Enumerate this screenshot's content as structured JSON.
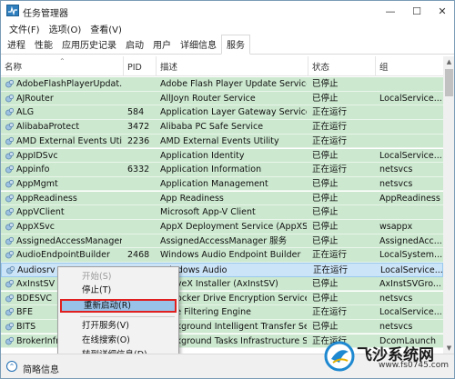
{
  "window": {
    "title": "任务管理器"
  },
  "menu": [
    "文件(F)",
    "选项(O)",
    "查看(V)"
  ],
  "tabs": [
    "进程",
    "性能",
    "应用历史记录",
    "启动",
    "用户",
    "详细信息",
    "服务"
  ],
  "active_tab": 6,
  "columns": {
    "name": "名称",
    "pid": "PID",
    "desc": "描述",
    "status": "状态",
    "group": "组"
  },
  "rows": [
    {
      "name": "AdobeFlashPlayerUpdat...",
      "pid": "",
      "desc": "Adobe Flash Player Update Service",
      "status": "已停止",
      "group": ""
    },
    {
      "name": "AJRouter",
      "pid": "",
      "desc": "AllJoyn Router Service",
      "status": "已停止",
      "group": "LocalService..."
    },
    {
      "name": "ALG",
      "pid": "584",
      "desc": "Application Layer Gateway Service",
      "status": "正在运行",
      "group": ""
    },
    {
      "name": "AlibabaProtect",
      "pid": "3472",
      "desc": "Alibaba PC Safe Service",
      "status": "正在运行",
      "group": ""
    },
    {
      "name": "AMD External Events Utili...",
      "pid": "2236",
      "desc": "AMD External Events Utility",
      "status": "正在运行",
      "group": ""
    },
    {
      "name": "AppIDSvc",
      "pid": "",
      "desc": "Application Identity",
      "status": "已停止",
      "group": "LocalService..."
    },
    {
      "name": "Appinfo",
      "pid": "6332",
      "desc": "Application Information",
      "status": "正在运行",
      "group": "netsvcs"
    },
    {
      "name": "AppMgmt",
      "pid": "",
      "desc": "Application Management",
      "status": "已停止",
      "group": "netsvcs"
    },
    {
      "name": "AppReadiness",
      "pid": "",
      "desc": "App Readiness",
      "status": "已停止",
      "group": "AppReadiness"
    },
    {
      "name": "AppVClient",
      "pid": "",
      "desc": "Microsoft App-V Client",
      "status": "已停止",
      "group": ""
    },
    {
      "name": "AppXSvc",
      "pid": "",
      "desc": "AppX Deployment Service (AppXS...",
      "status": "已停止",
      "group": "wsappx"
    },
    {
      "name": "AssignedAccessManager...",
      "pid": "",
      "desc": "AssignedAccessManager 服务",
      "status": "已停止",
      "group": "AssignedAcc..."
    },
    {
      "name": "AudioEndpointBuilder",
      "pid": "2468",
      "desc": "Windows Audio Endpoint Builder",
      "status": "正在运行",
      "group": "LocalSystem..."
    },
    {
      "name": "Audiosrv",
      "pid": "2640",
      "desc": "Windows Audio",
      "status": "正在运行",
      "group": "LocalService..."
    },
    {
      "name": "AxInstSV",
      "pid": "",
      "desc": "ActiveX Installer (AxInstSV)",
      "status": "已停止",
      "group": "AxInstSVGro..."
    },
    {
      "name": "BDESVC",
      "pid": "",
      "desc": "BitLocker Drive Encryption Service",
      "status": "已停止",
      "group": "netsvcs"
    },
    {
      "name": "BFE",
      "pid": "",
      "desc": "Base Filtering Engine",
      "status": "正在运行",
      "group": "LocalService..."
    },
    {
      "name": "BITS",
      "pid": "",
      "desc": "Background Intelligent Transfer Se...",
      "status": "已停止",
      "group": "netsvcs"
    },
    {
      "name": "BrokerInfrastructure",
      "pid": "",
      "desc": "Background Tasks Infrastructure S...",
      "status": "正在运行",
      "group": "DcomLaunch"
    }
  ],
  "context_menu": [
    "开始(S)",
    "停止(T)",
    "重新启动(R)",
    "打开服务(V)",
    "在线搜索(O)",
    "转到详细信息(D)"
  ],
  "status_bar": {
    "brief_label": "简略信息"
  },
  "watermark": {
    "title": "飞沙系统网",
    "url": "www.fs0745.com"
  },
  "colors": {
    "row_green": "#cce8cf",
    "highlight_red": "#e02020",
    "selection": "#99c2e8"
  }
}
